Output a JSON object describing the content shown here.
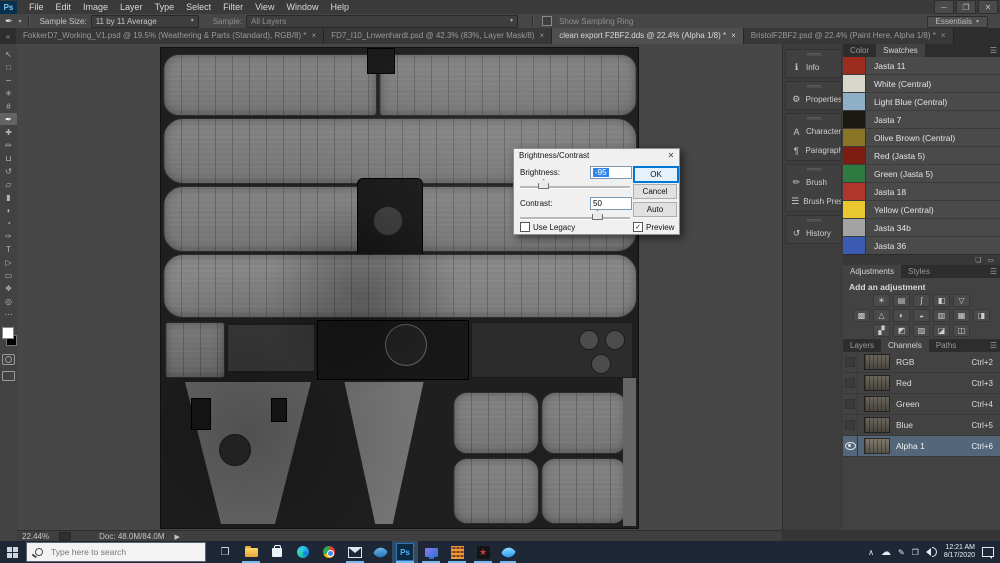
{
  "window": {
    "logo": "Ps",
    "controls": {
      "minimize": "─",
      "restore": "❐",
      "close": "✕"
    }
  },
  "menu_bar": {
    "items": [
      "File",
      "Edit",
      "Image",
      "Layer",
      "Type",
      "Select",
      "Filter",
      "View",
      "Window",
      "Help"
    ]
  },
  "options_bar": {
    "tool_icon": "✒",
    "caret": "▾",
    "sample_size_label": "Sample Size:",
    "sample_size_value": "11 by 11 Average",
    "sample_label": "Sample:",
    "sample_value": "All Layers",
    "show_sampling_ring_label": "Show Sampling Ring",
    "workspace_button": "Essentials"
  },
  "tab_bar": {
    "overflow_icon": "«",
    "tabs": [
      {
        "label": "FokkerD7_Working_V1.psd @ 19.5% (Weathering & Parts (Standard), RGB/8) *",
        "close": "×"
      },
      {
        "label": "FD7_I10_Lnwenhardt.psd @ 42.3% (83%, Layer Mask/8)",
        "close": "×"
      },
      {
        "label": "clean export F2BF2.dds @ 22.4% (Alpha 1/8) *",
        "close": "×"
      },
      {
        "label": "BristolF2BF2.psd @ 22.4% (Paint Here, Alpha 1/8) *",
        "close": "×"
      }
    ]
  },
  "toolbar": {
    "tools": [
      {
        "name": "move",
        "glyph": "↖"
      },
      {
        "name": "marquee",
        "glyph": "□"
      },
      {
        "name": "lasso",
        "glyph": "∽"
      },
      {
        "name": "quick-selection",
        "glyph": "✳"
      },
      {
        "name": "crop",
        "glyph": "#"
      },
      {
        "name": "eyedropper",
        "glyph": "✒"
      },
      {
        "name": "healing-brush",
        "glyph": "✚"
      },
      {
        "name": "brush",
        "glyph": "✏"
      },
      {
        "name": "clone-stamp",
        "glyph": "⊔"
      },
      {
        "name": "history-brush",
        "glyph": "↺"
      },
      {
        "name": "eraser",
        "glyph": "▱"
      },
      {
        "name": "gradient",
        "glyph": "▮"
      },
      {
        "name": "blur",
        "glyph": "◗"
      },
      {
        "name": "dodge",
        "glyph": "◔"
      },
      {
        "name": "pen",
        "glyph": "✑"
      },
      {
        "name": "type",
        "glyph": "T"
      },
      {
        "name": "path-selection",
        "glyph": "▷"
      },
      {
        "name": "shape",
        "glyph": "▭"
      },
      {
        "name": "hand",
        "glyph": "❖"
      },
      {
        "name": "zoom",
        "glyph": "◎"
      },
      {
        "name": "edit-toolbar",
        "glyph": "⋯"
      }
    ]
  },
  "dialog": {
    "title": "Brightness/Contrast",
    "close": "✕",
    "brightness_label": "Brightness:",
    "brightness_value": "-95",
    "contrast_label": "Contrast:",
    "contrast_value": "50",
    "ok": "OK",
    "cancel": "Cancel",
    "auto": "Auto",
    "use_legacy": "Use Legacy",
    "preview": "Preview",
    "check_glyph": "✓"
  },
  "collapsed_dock": {
    "panels": [
      {
        "icon": "ℹ",
        "label": "Info"
      },
      {
        "icon": "⚙",
        "label": "Properties"
      },
      {
        "icon": "A",
        "label": "Character"
      },
      {
        "icon": "¶",
        "label": "Paragraph"
      },
      {
        "icon": "✏",
        "label": "Brush"
      },
      {
        "icon": "☰",
        "label": "Brush Prese..."
      },
      {
        "icon": "↺",
        "label": "History"
      }
    ]
  },
  "swatches_panel": {
    "tab_color": "Color",
    "tab_swatches": "Swatches",
    "menu_icon": "☰",
    "items": [
      {
        "name": "Jasta 11",
        "color": "#9c2d1e"
      },
      {
        "name": "White (Central)",
        "color": "#d6d6cb"
      },
      {
        "name": "Light Blue (Central)",
        "color": "#8fafc6"
      },
      {
        "name": "Jasta 7",
        "color": "#1a1a12"
      },
      {
        "name": "Olive Brown (Central)",
        "color": "#8a7426"
      },
      {
        "name": "Red (Jasta 5)",
        "color": "#7d1d12"
      },
      {
        "name": "Green (Jasta 5)",
        "color": "#2f7a40"
      },
      {
        "name": "Jasta 18",
        "color": "#b0352a"
      },
      {
        "name": "Yellow (Central)",
        "color": "#e8c82e"
      },
      {
        "name": "Jasta 34b",
        "color": "#a3a3a3"
      },
      {
        "name": "Jasta 36",
        "color": "#3c5cb4"
      }
    ],
    "partial_color": "#1c2430",
    "footer_icons": [
      "❏",
      "▭"
    ]
  },
  "adjustments_panel": {
    "tab_adjustments": "Adjustments",
    "tab_styles": "Styles",
    "menu_icon": "☰",
    "heading": "Add an adjustment",
    "row1": [
      "☀",
      "▤",
      "∫",
      "◧",
      "▽"
    ],
    "row2": [
      "▩",
      "△",
      "◐",
      "◒",
      "▥",
      "▦",
      "◨"
    ],
    "row3": [
      "▞",
      "◩",
      "▨",
      "◪",
      "◫"
    ]
  },
  "channels_panel": {
    "tab_layers": "Layers",
    "tab_channels": "Channels",
    "tab_paths": "Paths",
    "menu_icon": "☰",
    "rows": [
      {
        "name": "RGB",
        "shortcut": "Ctrl+2"
      },
      {
        "name": "Red",
        "shortcut": "Ctrl+3"
      },
      {
        "name": "Green",
        "shortcut": "Ctrl+4"
      },
      {
        "name": "Blue",
        "shortcut": "Ctrl+5"
      },
      {
        "name": "Alpha 1",
        "shortcut": "Ctrl+6"
      }
    ],
    "footer_icons": [
      "◌",
      "⊙",
      "❏",
      "▭"
    ]
  },
  "status_bar": {
    "zoom": "22.44%",
    "doc": "Doc: 48.0M/84.0M",
    "arrow": "▶"
  },
  "taskbar": {
    "search_placeholder": "Type here to search",
    "photoshop_label": "Ps",
    "tray_chevron": "∧",
    "tray_cloud": "☁",
    "tray_pen": "✎",
    "tray_monitors": "❐",
    "clock_time": "12:21 AM",
    "clock_date": "8/17/2020"
  },
  "accent_colors": {
    "taskbar_underline": "#76b9ed",
    "selection_blue": "#2f86e8",
    "channel_selected": "#54677a"
  }
}
